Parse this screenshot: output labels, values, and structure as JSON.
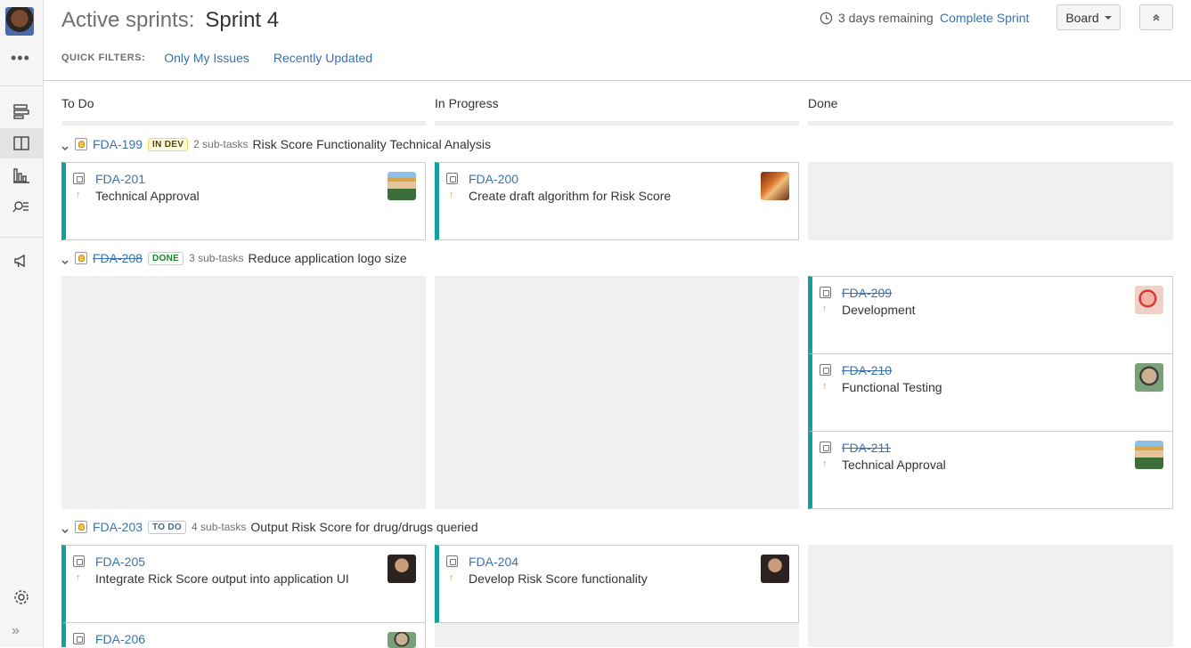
{
  "header": {
    "title_prefix": "Active sprints:",
    "sprint_name": "Sprint 4",
    "remaining": "3 days remaining",
    "complete_label": "Complete Sprint",
    "board_label": "Board"
  },
  "quick_filters": {
    "label": "QUICK FILTERS:",
    "items": [
      "Only My Issues",
      "Recently Updated"
    ]
  },
  "columns": [
    "To Do",
    "In Progress",
    "Done"
  ],
  "swimlanes": [
    {
      "key": "FDA-199",
      "status": "IN DEV",
      "subtasks": "2 sub-tasks",
      "summary": "Risk Score Functionality Technical Analysis",
      "cards": {
        "todo": [
          {
            "key": "FDA-201",
            "summary": "Technical Approval"
          }
        ],
        "inprogress": [
          {
            "key": "FDA-200",
            "summary": "Create draft algorithm for Risk Score"
          }
        ],
        "done": []
      }
    },
    {
      "key": "FDA-208",
      "status": "DONE",
      "subtasks": "3 sub-tasks",
      "summary": "Reduce application logo size",
      "cards": {
        "todo": [],
        "inprogress": [],
        "done": [
          {
            "key": "FDA-209",
            "summary": "Development"
          },
          {
            "key": "FDA-210",
            "summary": "Functional Testing"
          },
          {
            "key": "FDA-211",
            "summary": "Technical Approval"
          }
        ]
      }
    },
    {
      "key": "FDA-203",
      "status": "TO DO",
      "subtasks": "4 sub-tasks",
      "summary": "Output Risk Score for drug/drugs queried",
      "cards": {
        "todo": [
          {
            "key": "FDA-205",
            "summary": "Integrate Rick Score output into application UI"
          },
          {
            "key": "FDA-206",
            "summary": ""
          }
        ],
        "inprogress": [
          {
            "key": "FDA-204",
            "summary": "Develop Risk Score functionality"
          }
        ],
        "done": []
      }
    }
  ],
  "colors": {
    "link": "#3b73af",
    "card_accent": "#14a09b",
    "priority": "#f79232",
    "done_badge": "#14892c",
    "indev_badge": "#594300"
  }
}
